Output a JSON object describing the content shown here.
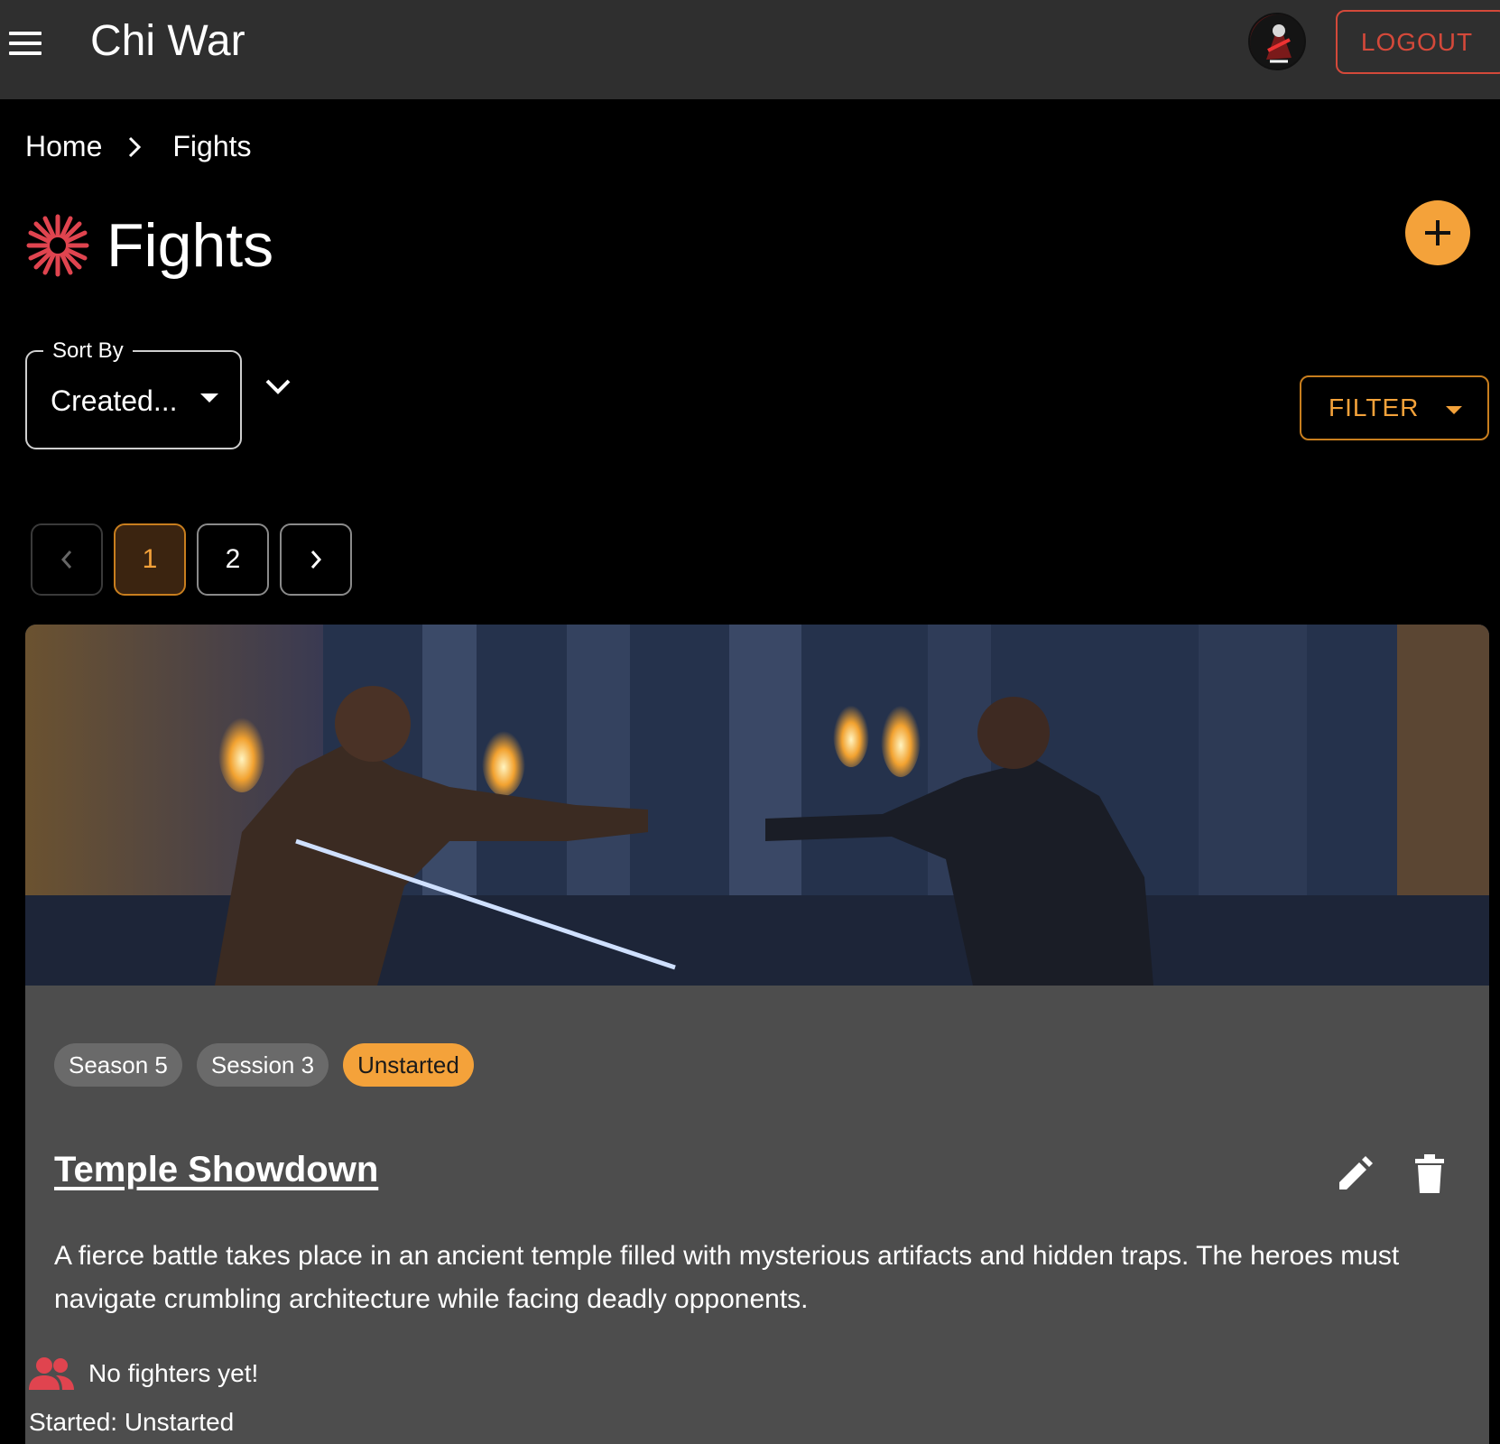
{
  "app": {
    "title": "Chi War",
    "logout_label": "LOGOUT"
  },
  "breadcrumb": {
    "home": "Home",
    "current": "Fights"
  },
  "page": {
    "title": "Fights"
  },
  "sort": {
    "legend": "Sort By",
    "value": "Created..."
  },
  "filter": {
    "label": "FILTER"
  },
  "pagination": {
    "pages": [
      "1",
      "2"
    ],
    "current": "1"
  },
  "fight": {
    "badges": [
      "Season 5",
      "Session 3",
      "Unstarted"
    ],
    "title": "Temple Showdown",
    "description": "A fierce battle takes place in an ancient temple filled with mysterious artifacts and hidden traps. The heroes must navigate crumbling architecture while facing deadly opponents.",
    "fighters_text": "No fighters yet!",
    "started": "Started: Unstarted"
  },
  "colors": {
    "accent": "#f4a23a",
    "logout": "#d4493a",
    "appbar": "#2f2f2f",
    "card": "#4d4d4d",
    "fighters_icon": "#e0444f"
  },
  "icons": {
    "menu": "hamburger-menu-icon",
    "breadcrumb_sep": "chevron-right-icon",
    "page": "burst-icon",
    "add": "plus-icon",
    "sort_dir": "chevron-down-icon",
    "prev": "chevron-left-icon",
    "next": "chevron-right-icon",
    "edit": "pencil-icon",
    "delete": "trash-icon",
    "fighters": "people-icon"
  }
}
